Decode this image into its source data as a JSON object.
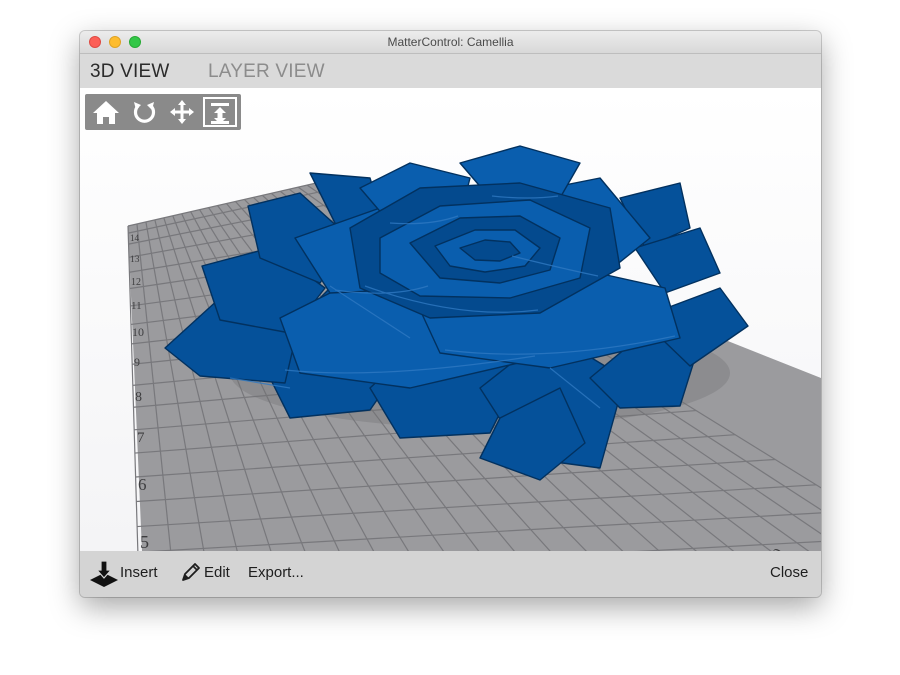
{
  "window": {
    "title": "MatterControl: Camellia"
  },
  "tabs": [
    {
      "label": "3D VIEW"
    },
    {
      "label": "LAYER VIEW"
    }
  ],
  "view_controls": {
    "home_icon": "home-icon",
    "rotate_icon": "rotate-icon",
    "move_icon": "move-icon",
    "scale_icon": "scale-icon",
    "active": "scale-icon"
  },
  "bed": {
    "ruler_labels": [
      "14",
      "13",
      "12",
      "11",
      "10",
      "9",
      "8",
      "7",
      "6",
      "5"
    ],
    "corner_label": "0"
  },
  "model": {
    "color": "#05519a"
  },
  "bottom": {
    "insert": "Insert",
    "edit": "Edit",
    "export": "Export...",
    "close": "Close"
  }
}
